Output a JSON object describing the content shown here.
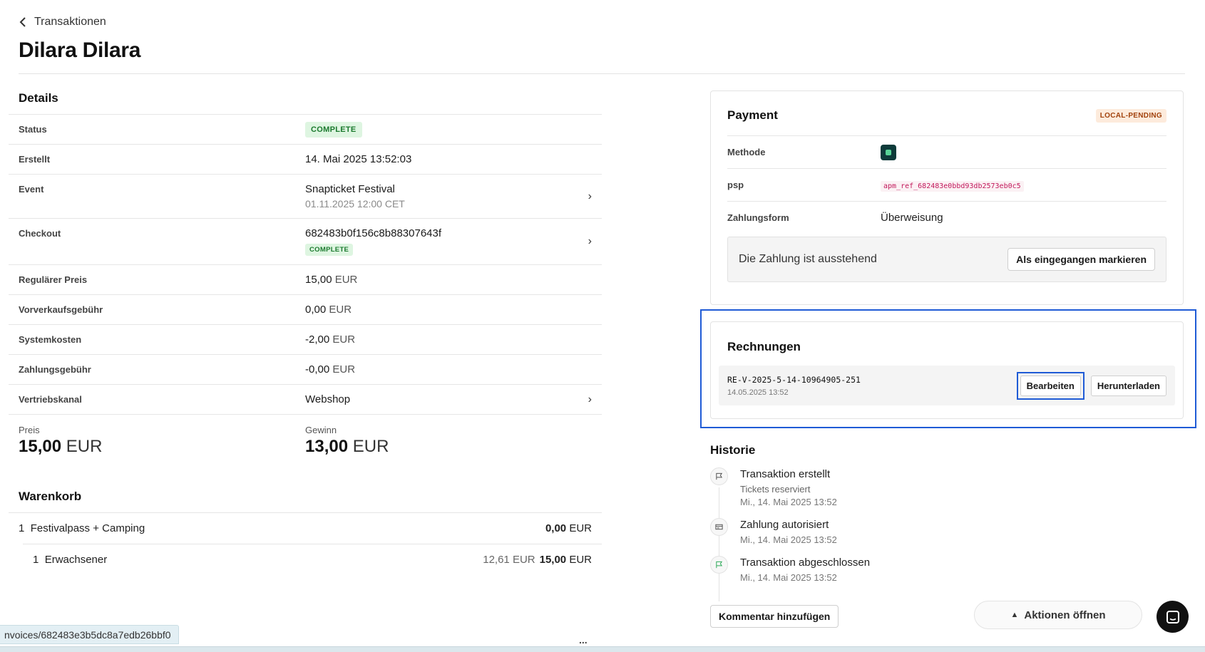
{
  "header": {
    "back_label": "Transaktionen",
    "title": "Dilara Dilara"
  },
  "details": {
    "heading": "Details",
    "status_label": "Status",
    "status_value": "COMPLETE",
    "created_label": "Erstellt",
    "created_value": "14. Mai 2025 13:52:03",
    "event_label": "Event",
    "event_name": "Snapticket Festival",
    "event_date": "01.11.2025 12:00 CET",
    "checkout_label": "Checkout",
    "checkout_id": "682483b0f156c8b88307643f",
    "checkout_status": "COMPLETE",
    "regular_price_label": "Regulärer Preis",
    "regular_price_amount": "15,00",
    "presale_fee_label": "Vorverkaufsgebühr",
    "presale_fee_amount": "0,00",
    "system_costs_label": "Systemkosten",
    "system_costs_amount": "-2,00",
    "payment_fee_label": "Zahlungsgebühr",
    "payment_fee_amount": "-0,00",
    "channel_label": "Vertriebskanal",
    "channel_value": "Webshop",
    "currency": "EUR",
    "price_label": "Preis",
    "price_amount": "15,00",
    "profit_label": "Gewinn",
    "profit_amount": "13,00"
  },
  "cart": {
    "heading": "Warenkorb",
    "items": [
      {
        "qty": "1",
        "name": "Festivalpass + Camping",
        "amount": "0,00",
        "currency": "EUR"
      },
      {
        "qty": "1",
        "name": "Erwachsener",
        "net": "12,61 EUR",
        "amount": "15,00",
        "currency": "EUR"
      }
    ]
  },
  "payment": {
    "heading": "Payment",
    "badge": "LOCAL-PENDING",
    "method_label": "Methode",
    "method_icon": "bank-transfer-icon",
    "psp_label": "psp",
    "psp_value": "apm_ref_682483e0bbd93db2573eb0c5",
    "form_label": "Zahlungsform",
    "form_value": "Überweisung",
    "pending_text": "Die Zahlung ist ausstehend",
    "mark_received_label": "Als eingegangen markieren"
  },
  "invoices": {
    "heading": "Rechnungen",
    "items": [
      {
        "number": "RE-V-2025-5-14-10964905-251",
        "date": "14.05.2025 13:52",
        "edit_label": "Bearbeiten",
        "download_label": "Herunterladen"
      }
    ]
  },
  "history": {
    "heading": "Historie",
    "items": [
      {
        "title": "Transaktion erstellt",
        "subtitle": "Tickets reserviert",
        "date": "Mi., 14. Mai 2025 13:52",
        "icon": "flag-icon"
      },
      {
        "title": "Zahlung autorisiert",
        "date": "Mi., 14. Mai 2025 13:52",
        "icon": "card-icon"
      },
      {
        "title": "Transaktion abgeschlossen",
        "date": "Mi., 14. Mai 2025 13:52",
        "icon": "flag-green-icon"
      }
    ]
  },
  "footer": {
    "comment_button": "Kommentar hinzufügen",
    "actions_button": "Aktionen öffnen",
    "status_url": "nvoices/682483e3b5dc8a7edb26bbf0",
    "more_dots": "..."
  },
  "colors": {
    "highlight": "#1f5bd6",
    "complete_bg": "#def5e1",
    "complete_text": "#1b7a2e",
    "pending_bg": "#fdebdc",
    "pending_text": "#a1420c",
    "psp_code": "#c2185b"
  }
}
